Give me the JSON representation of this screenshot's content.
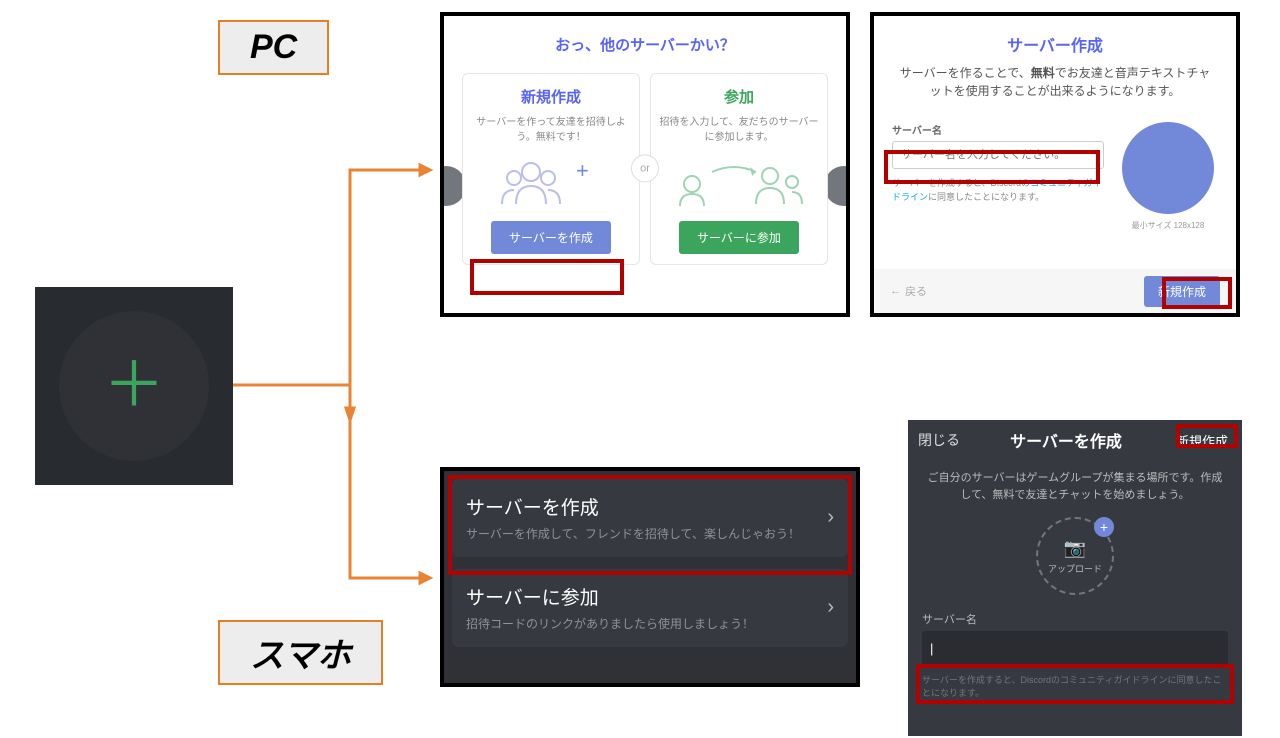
{
  "labels": {
    "pc": "PC",
    "sp": "スマホ"
  },
  "plus": {
    "symbol": "＋"
  },
  "pc1": {
    "title": "おっ、他のサーバーかい？",
    "or": "or",
    "create": {
      "title": "新規作成",
      "desc": "サーバーを作って友達を招待しよう。無料です！",
      "button": "サーバーを作成"
    },
    "join": {
      "title": "参加",
      "desc": "招待を入力して、友だちのサーバーに参加します。",
      "button": "サーバーに参加"
    }
  },
  "pc2": {
    "title": "サーバー作成",
    "desc1": "サーバーを作ることで、",
    "desc_bold": "無料",
    "desc2": "でお友達と音声テキストチャットを使用することが出来るようになります。",
    "label": "サーバー名",
    "placeholder": "サーバー名を入力してください。",
    "note1": "サーバーを作成すると、Discordの",
    "note_link": "コミュニティガイドライン",
    "note2": "に同意したことになります。",
    "size": "最小サイズ 128x128",
    "back": "戻る",
    "create": "新規作成"
  },
  "sp1": {
    "create": {
      "title": "サーバーを作成",
      "desc": "サーバーを作成して、フレンドを招待して、楽しんじゃおう！"
    },
    "join": {
      "title": "サーバーに参加",
      "desc": "招待コードのリンクがありましたら使用しましょう！"
    }
  },
  "sp2": {
    "close": "閉じる",
    "title": "サーバーを作成",
    "new": "新規作成",
    "desc": "ご自分のサーバーはゲームグループが集まる場所です。作成して、無料で友達とチャットを始めましょう。",
    "upload": "アップロード",
    "label": "サーバー名",
    "input_value": "|",
    "note": "サーバーを作成すると、Discordのコミュニティガイドラインに同意したことになります。"
  }
}
